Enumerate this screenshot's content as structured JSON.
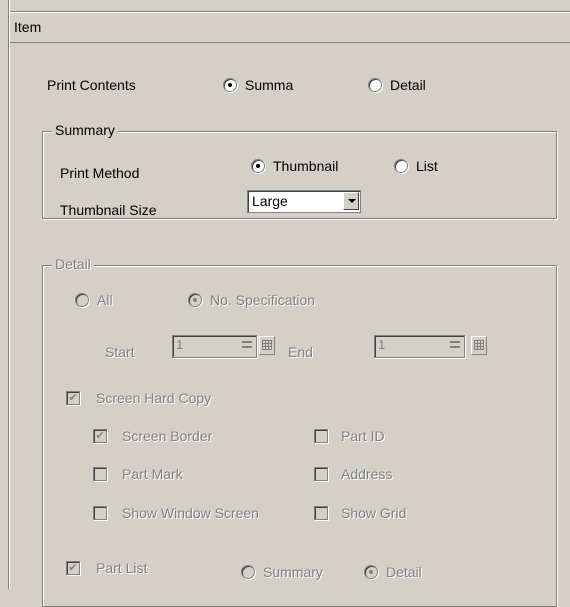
{
  "header": {
    "title": "Item"
  },
  "print_contents": {
    "label": "Print Contents",
    "option_summary": "Summa",
    "option_detail": "Detail",
    "selected": "Summa"
  },
  "summary_group": {
    "legend": "Summary",
    "print_method_label": "Print Method",
    "method_thumbnail": "Thumbnail",
    "method_list": "List",
    "thumbnail_size_label": "Thumbnail Size",
    "thumbnail_size_value": "Large"
  },
  "detail_group": {
    "legend": "Detail",
    "all_label": "All",
    "no_spec_label": "No. Specification",
    "start_label": "Start",
    "start_value": "1",
    "end_label": "End",
    "end_value": "1",
    "screen_hard_copy": "Screen Hard Copy",
    "screen_border": "Screen Border",
    "part_id": "Part ID",
    "part_mark": "Part Mark",
    "address": "Address",
    "show_window_screen": "Show Window Screen",
    "show_grid": "Show Grid",
    "part_list": "Part List",
    "part_list_summary": "Summary",
    "part_list_detail": "Detail",
    "check_glyph": "✔"
  }
}
